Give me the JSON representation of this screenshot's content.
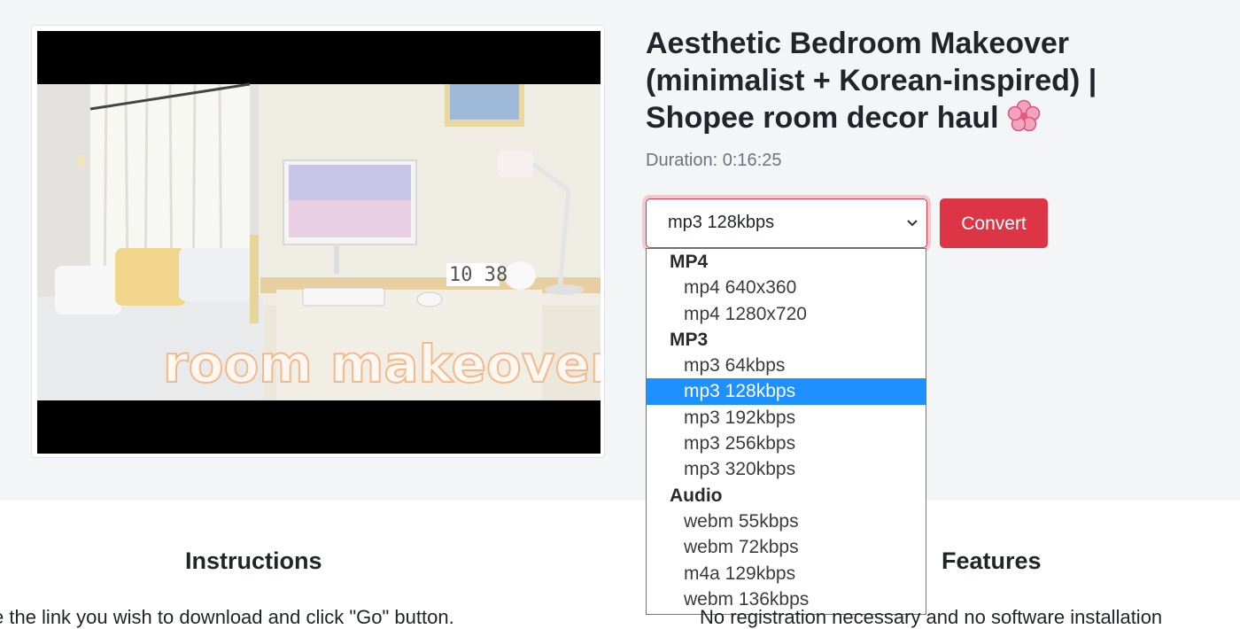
{
  "video": {
    "title": "Aesthetic Bedroom Makeover (minimalist + Korean-inspired) | Shopee room decor haul",
    "title_emoji": "🌸",
    "duration": "Duration: 0:16:25",
    "thumbnail_caption": "room makeover",
    "thumbnail_clock": "10 38"
  },
  "converter": {
    "selected_format": "mp3 128kbps",
    "convert_label": "Convert",
    "groups": [
      {
        "label": "MP4",
        "options": [
          "mp4 640x360",
          "mp4 1280x720"
        ]
      },
      {
        "label": "MP3",
        "options": [
          "mp3 64kbps",
          "mp3 128kbps",
          "mp3 192kbps",
          "mp3 256kbps",
          "mp3 320kbps"
        ]
      },
      {
        "label": "Audio",
        "options": [
          "webm 55kbps",
          "webm 72kbps",
          "m4a 129kbps",
          "webm 136kbps"
        ]
      }
    ]
  },
  "sections": {
    "instructions_title": "Instructions",
    "features_title": "Features",
    "instructions_first_line": "e the link you wish to download and click \"Go\" button.",
    "features_first_line": "No registration necessary and no software installation"
  },
  "colors": {
    "accent": "#dc3545",
    "selected_option_bg": "#1e90ff",
    "page_band": "#f4f5f7"
  }
}
